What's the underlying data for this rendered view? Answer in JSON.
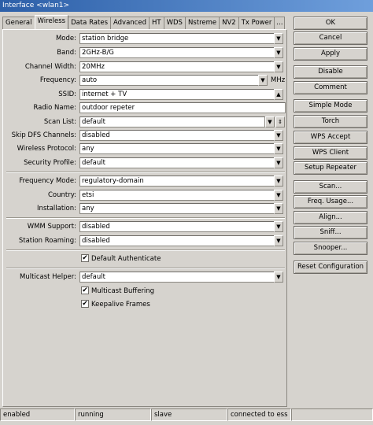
{
  "window": {
    "title": "Interface <wlan1>"
  },
  "tabs": [
    "General",
    "Wireless",
    "Data Rates",
    "Advanced",
    "HT",
    "WDS",
    "Nstreme",
    "NV2",
    "Tx Power"
  ],
  "tabs_menu": "...",
  "form": {
    "mode": {
      "label": "Mode",
      "value": "station bridge"
    },
    "band": {
      "label": "Band",
      "value": "2GHz-B/G"
    },
    "channel_width": {
      "label": "Channel Width",
      "value": "20MHz"
    },
    "frequency": {
      "label": "Frequency",
      "value": "auto",
      "unit": "MHz"
    },
    "ssid": {
      "label": "SSID",
      "value": "internet + TV"
    },
    "radio_name": {
      "label": "Radio Name",
      "value": "outdoor repeter"
    },
    "scan_list": {
      "label": "Scan List",
      "value": "default"
    },
    "skip_dfs": {
      "label": "Skip DFS Channels",
      "value": "disabled"
    },
    "wireless_protocol": {
      "label": "Wireless Protocol",
      "value": "any"
    },
    "security_profile": {
      "label": "Security Profile",
      "value": "default"
    },
    "frequency_mode": {
      "label": "Frequency Mode",
      "value": "regulatory-domain"
    },
    "country": {
      "label": "Country",
      "value": "etsi"
    },
    "installation": {
      "label": "Installation",
      "value": "any"
    },
    "wmm_support": {
      "label": "WMM Support",
      "value": "disabled"
    },
    "station_roaming": {
      "label": "Station Roaming",
      "value": "disabled"
    },
    "default_authenticate": {
      "label": "Default Authenticate",
      "checked": true
    },
    "multicast_helper": {
      "label": "Multicast Helper",
      "value": "default"
    },
    "multicast_buffering": {
      "label": "Multicast Buffering",
      "checked": true
    },
    "keepalive_frames": {
      "label": "Keepalive Frames",
      "checked": true
    }
  },
  "buttons": {
    "ok": "OK",
    "cancel": "Cancel",
    "apply": "Apply",
    "disable": "Disable",
    "comment": "Comment",
    "simple_mode": "Simple Mode",
    "torch": "Torch",
    "wps_accept": "WPS Accept",
    "wps_client": "WPS Client",
    "setup_repeater": "Setup Repeater",
    "scan": "Scan...",
    "freq_usage": "Freq. Usage...",
    "align": "Align...",
    "sniff": "Sniff...",
    "snooper": "Snooper...",
    "reset_configuration": "Reset Configuration"
  },
  "status": {
    "enabled": "enabled",
    "running": "running",
    "slave": "slave",
    "connection": "connected to ess"
  },
  "glyphs": {
    "dropdown": "▼",
    "updown": "⇕",
    "up": "▲",
    "check": "✔"
  }
}
